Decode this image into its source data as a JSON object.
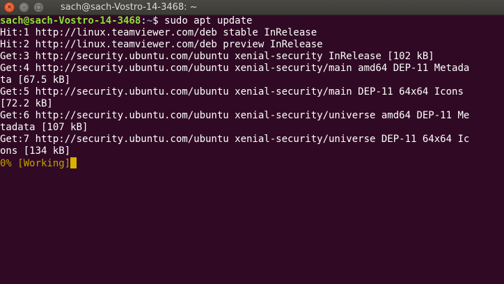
{
  "window": {
    "title": "sach@sach-Vostro-14-3468: ~",
    "close_glyph": "✕",
    "minimize_glyph": "–",
    "maximize_glyph": "□"
  },
  "terminal": {
    "prompt": {
      "user_host": "sach@sach-Vostro-14-3468",
      "separator": ":",
      "path": "~",
      "symbol": "$ ",
      "command": "sudo apt update"
    },
    "lines": [
      "Hit:1 http://linux.teamviewer.com/deb stable InRelease",
      "Hit:2 http://linux.teamviewer.com/deb preview InRelease",
      "Get:3 http://security.ubuntu.com/ubuntu xenial-security InRelease [102 kB]",
      "Get:4 http://security.ubuntu.com/ubuntu xenial-security/main amd64 DEP-11 Metada",
      "ta [67.5 kB]",
      "Get:5 http://security.ubuntu.com/ubuntu xenial-security/main DEP-11 64x64 Icons",
      "[72.2 kB]",
      "Get:6 http://security.ubuntu.com/ubuntu xenial-security/universe amd64 DEP-11 Me",
      "tadata [107 kB]",
      "Get:7 http://security.ubuntu.com/ubuntu xenial-security/universe DEP-11 64x64 Ic",
      "ons [134 kB]"
    ],
    "progress": "0% [Working]"
  },
  "colors": {
    "background": "#300a24",
    "user_host": "#8ae234",
    "path": "#729fcf",
    "progress": "#c4a000",
    "cursor": "#dab000"
  }
}
